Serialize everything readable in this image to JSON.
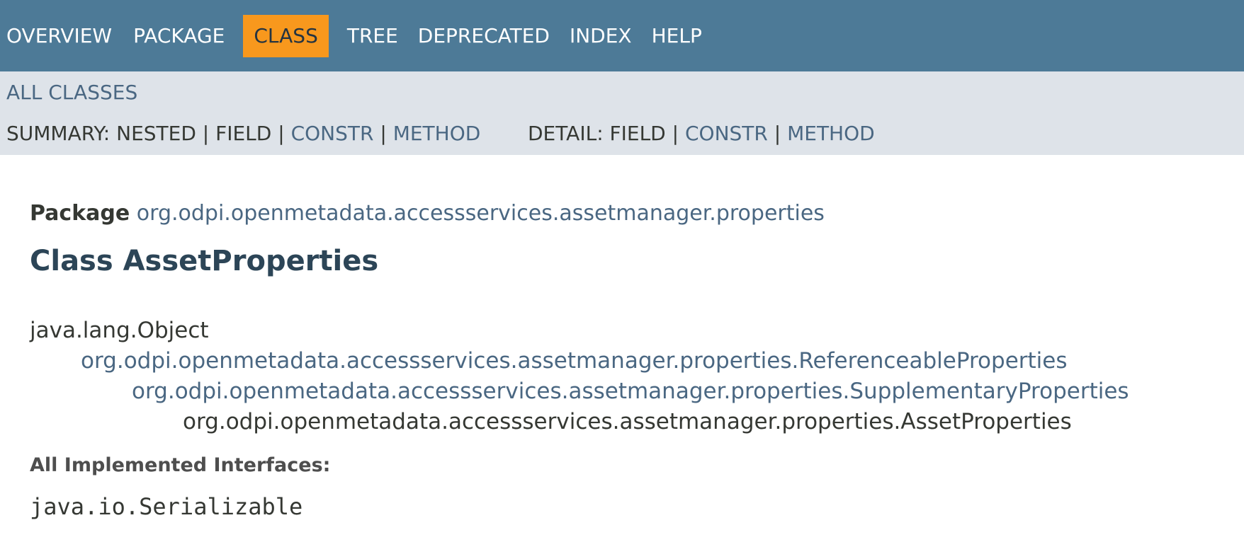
{
  "top_nav": {
    "items": [
      {
        "label": "OVERVIEW",
        "active": false
      },
      {
        "label": "PACKAGE",
        "active": false
      },
      {
        "label": "CLASS",
        "active": true
      },
      {
        "label": "TREE",
        "active": false
      },
      {
        "label": "DEPRECATED",
        "active": false
      },
      {
        "label": "INDEX",
        "active": false
      },
      {
        "label": "HELP",
        "active": false
      }
    ],
    "background_color": "#4d7a97",
    "active_color": "#f8981d"
  },
  "sub_nav": {
    "all_classes": "ALL CLASSES",
    "summary": {
      "prefix": "SUMMARY: ",
      "nested": "NESTED",
      "field": "FIELD",
      "constr": "CONSTR",
      "method": "METHOD",
      "sep": " | "
    },
    "detail": {
      "prefix": "DETAIL: ",
      "field": "FIELD",
      "constr": "CONSTR",
      "method": "METHOD",
      "sep": " | "
    }
  },
  "header": {
    "package_label": "Package",
    "package_name": "org.odpi.openmetadata.accessservices.assetmanager.properties",
    "class_title": "Class AssetProperties"
  },
  "inheritance": {
    "items": [
      "java.lang.Object",
      "org.odpi.openmetadata.accessservices.assetmanager.properties.ReferenceableProperties",
      "org.odpi.openmetadata.accessservices.assetmanager.properties.SupplementaryProperties",
      "org.odpi.openmetadata.accessservices.assetmanager.properties.AssetProperties"
    ]
  },
  "interfaces": {
    "label": "All Implemented Interfaces:",
    "value": "java.io.Serializable"
  }
}
